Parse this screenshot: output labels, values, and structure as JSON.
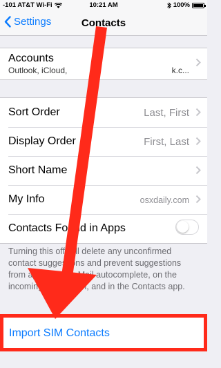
{
  "status_bar": {
    "carrier": "-101 AT&T Wi-Fi",
    "time": "10:21 AM",
    "battery": "100%"
  },
  "nav": {
    "back_label": "Settings",
    "title": "Contacts"
  },
  "accounts": {
    "label": "Accounts",
    "subtitle": "Outlook, iCloud,",
    "subtitle_end": "k.c..."
  },
  "settings": [
    {
      "label": "Sort Order",
      "value": "Last, First"
    },
    {
      "label": "Display Order",
      "value": "First, Last"
    },
    {
      "label": "Short Name",
      "value": ""
    },
    {
      "label": "My Info",
      "value": "osxdaily.com"
    },
    {
      "label": "Contacts Found in Apps",
      "toggle_on": false
    }
  ],
  "footer_note": "Turning this off will delete any unconfirmed contact suggestions and prevent suggestions from appearing in Mail autocomplete, on the incoming call screen, and in the Contacts app.",
  "import": {
    "label": "Import SIM Contacts"
  },
  "colors": {
    "accent_blue": "#0a7bff",
    "annotation_red": "#ff2a1a",
    "background": "#efeff4"
  }
}
